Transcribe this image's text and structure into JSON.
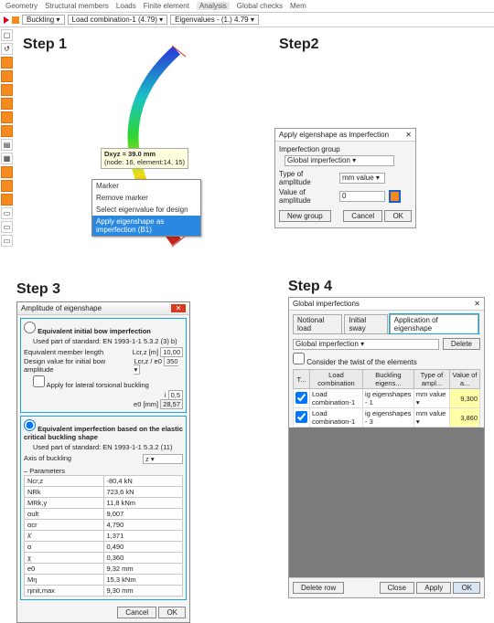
{
  "topmenu": {
    "items": [
      "Geometry",
      "Structural members",
      "Loads",
      "Finite element",
      "Analysis",
      "Global checks",
      "Mem"
    ],
    "active": "Analysis"
  },
  "controlbar": {
    "analysis_type": "Buckling",
    "load_combo": "Load combination-1 (4.79)",
    "eigen_sel": "Eigenvalues - (1.)  4.79"
  },
  "steps": {
    "s1": "Step 1",
    "s2": "Step2",
    "s3": "Step 3",
    "s4": "Step 4"
  },
  "tooltip1": {
    "l1": "Dxyz = 39.0 mm",
    "l2": "(node: 16, element:14, 15)"
  },
  "ctxmenu": {
    "items": [
      "Marker",
      "Remove marker",
      "Select eigenvalue for design"
    ],
    "highlighted": "Apply eigenshape as imperfection (B1)"
  },
  "step2": {
    "title": "Apply eigenshape as imperfection",
    "grp_label": "Imperfection group",
    "grp_value": "Global imperfection",
    "type_label": "Type of amplitude",
    "type_value": "mm value",
    "value_label": "Value of amplitude",
    "value_value": "0",
    "btn_new": "New group",
    "btn_cancel": "Cancel",
    "btn_ok": "OK"
  },
  "step3": {
    "title": "Amplitude of eigenshape",
    "sec1": {
      "head": "Equivalent initial bow imperfection",
      "std": "Used part of standard:  EN 1993-1-1 5.3.2 (3) b)",
      "len_label": "Equivalent member length",
      "len_unit": "Lcr,z [m]",
      "len_val": "10,00",
      "design_label": "Design value for initial bow amplitude",
      "design_unit": "Lcr,z / e0",
      "design_val": "350",
      "chk": "Apply for lateral torsional buckling",
      "i_lbl": "i",
      "i_val": "0,5",
      "e0_lbl": "e0 [mm]",
      "e0_val": "28,57"
    },
    "sec2": {
      "head": "Equivalent imperfection based on the elastic critical buckling shape",
      "std": "Used part of standard:  EN 1993-1-1 5.3.2 (11)",
      "axis_label": "Axis of buckling",
      "axis_value": "z",
      "params": "Parameters",
      "rows": [
        [
          "Ncr,z",
          "-80,4 kN"
        ],
        [
          "NRk",
          "723,6 kN"
        ],
        [
          "MRk,y",
          "11,8 kNm"
        ],
        [
          "αult",
          "9,007"
        ],
        [
          "αcr",
          "4,790"
        ],
        [
          "λ̄",
          "1,371"
        ],
        [
          "α",
          "0,490"
        ],
        [
          "χ",
          "0,360"
        ],
        [
          "e0",
          "9,32 mm"
        ],
        [
          "Mη",
          "15,3 kNm"
        ],
        [
          "ηinit,max",
          "9,30 mm"
        ]
      ]
    },
    "btn_cancel": "Cancel",
    "btn_ok": "OK"
  },
  "step4": {
    "title": "Global imperfections",
    "tabs": [
      "Notional load",
      "Initial sway",
      "Application of eigenshape"
    ],
    "active_tab": "Application of eigenshape",
    "group_sel": "Global imperfection",
    "btn_delete": "Delete",
    "chk": "Consider the twist of the elements",
    "cols": [
      "T...",
      "Load combination",
      "Buckling eigens...",
      "Type of ampl...",
      "Value of a..."
    ],
    "rows": [
      {
        "chk": true,
        "lc": "Load combination-1",
        "be": "ig eigenshapes - 1",
        "ty": "mm value",
        "va": "9,300"
      },
      {
        "chk": true,
        "lc": "Load combination-1",
        "be": "ig eigenshapes - 3",
        "ty": "mm value",
        "va": "3,860"
      }
    ],
    "btn_deleterow": "Delete row",
    "btn_close": "Close",
    "btn_apply": "Apply",
    "btn_ok": "OK"
  }
}
